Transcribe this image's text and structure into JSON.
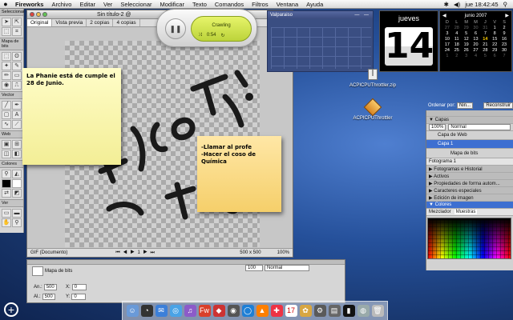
{
  "menubar": {
    "apple_icon": "apple-icon",
    "items": [
      "Fireworks",
      "Archivo",
      "Editar",
      "Ver",
      "Seleccionar",
      "Modificar",
      "Texto",
      "Comandos",
      "Filtros",
      "Ventana",
      "Ayuda"
    ],
    "clock": "jue 18:42:45"
  },
  "tools": {
    "title": "Seleccionar",
    "bitmap_label": "Mapa de bits",
    "vector_label": "Vector",
    "web_label": "Web",
    "colors_label": "Colores",
    "view_label": "Ver"
  },
  "document": {
    "title": "Sin título-2 @",
    "tabs": [
      "Original",
      "Vista previa",
      "2 copias",
      "4 copias"
    ],
    "status_left": "GIF (Documento)",
    "status_nav": "⏮ ◀ ▶ 1 ▶ ⏭",
    "status_size": "500 x 500",
    "status_zoom": "100%"
  },
  "sticky1": {
    "text": "La Phanie está de cumple el 28 de Junio."
  },
  "sticky2": {
    "line1": "-Llamar al profe",
    "line2": "-Hacer el coso de Química"
  },
  "itunes": {
    "track": "Crawling",
    "time": "0:54",
    "play_symbol": "❚❚"
  },
  "valparaiso": {
    "title": "Valparaiso",
    "controls": "— —"
  },
  "day_widget": {
    "day_name": "jueves",
    "day_number": "14"
  },
  "calendar": {
    "month": "junio 2007",
    "dow": [
      "D",
      "L",
      "M",
      "M",
      "J",
      "V",
      "S"
    ],
    "weeks": [
      [
        "27",
        "28",
        "29",
        "30",
        "31",
        "1",
        "2"
      ],
      [
        "3",
        "4",
        "5",
        "6",
        "7",
        "8",
        "9"
      ],
      [
        "10",
        "11",
        "12",
        "13",
        "14",
        "15",
        "16"
      ],
      [
        "17",
        "18",
        "19",
        "20",
        "21",
        "22",
        "23"
      ],
      [
        "24",
        "25",
        "26",
        "27",
        "28",
        "29",
        "30"
      ],
      [
        "1",
        "2",
        "3",
        "4",
        "5",
        "6",
        "7"
      ]
    ],
    "today": "14"
  },
  "desktop_icons": {
    "zip": "ACPICPUThrottler.zip",
    "app": "ACPICPUThrottler"
  },
  "right_panel": {
    "ordenar_label": "Ordenar por:",
    "ordenar_value": "Nin...",
    "reconstruir": "Reconstruir",
    "capas": "▼ Capas",
    "opacity": "100%",
    "blend": "Normal",
    "layer_web": "Capa de Web",
    "layer_1": "Capa 1",
    "frame": "Fotograma 1",
    "bitmap": "Mapa de bits",
    "sections": [
      "▶ Fotogramas e Historial",
      "▶ Activos",
      "▶ Propiedades de forma autom...",
      "▶ Caracteres especiales",
      "▶ Edición de imagen"
    ],
    "colores": "▼ Colores",
    "mezclador": "Mezclador",
    "muestras": "Muestras"
  },
  "properties": {
    "type_label": "Mapa de bits",
    "an_label": "An.:",
    "an_value": "500",
    "al_label": "Al.:",
    "al_value": "500",
    "x_label": "X:",
    "x_value": "0",
    "y_label": "Y:",
    "y_value": "0",
    "opacity": "100",
    "blend": "Normal"
  }
}
